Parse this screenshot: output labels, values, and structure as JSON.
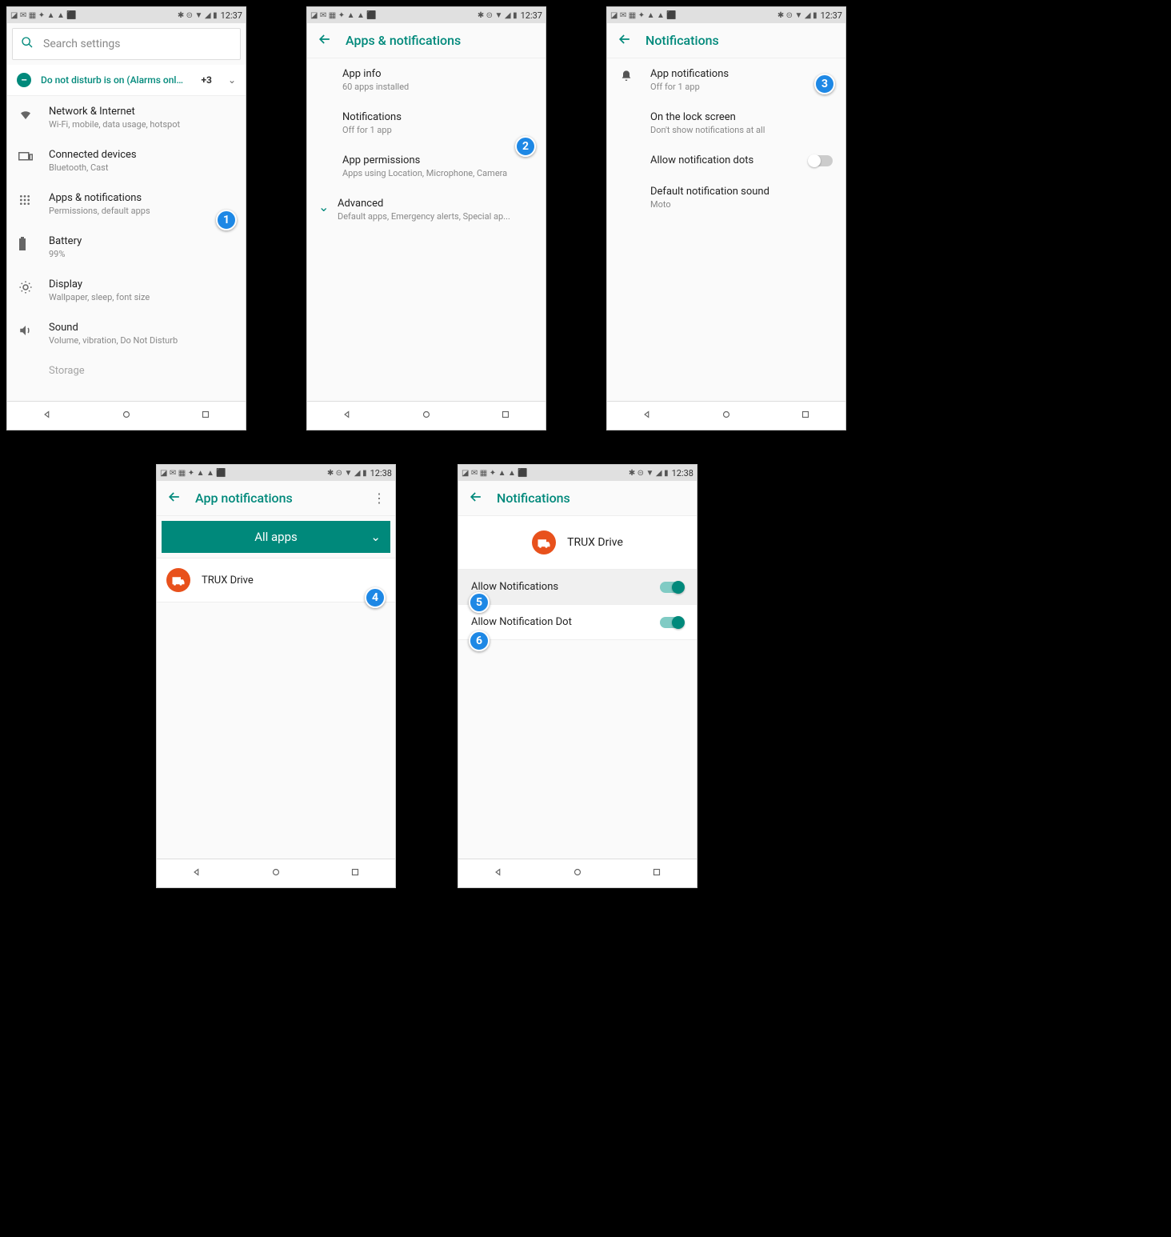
{
  "status_time_a": "12:37",
  "status_time_b": "12:38",
  "phone1": {
    "search_placeholder": "Search settings",
    "dnd_text": "Do not disturb is on (Alarms onl…",
    "dnd_more": "+3",
    "items": [
      {
        "title": "Network & Internet",
        "sub": "Wi-Fi, mobile, data usage, hotspot"
      },
      {
        "title": "Connected devices",
        "sub": "Bluetooth, Cast"
      },
      {
        "title": "Apps & notifications",
        "sub": "Permissions, default apps"
      },
      {
        "title": "Battery",
        "sub": "99%"
      },
      {
        "title": "Display",
        "sub": "Wallpaper, sleep, font size"
      },
      {
        "title": "Sound",
        "sub": "Volume, vibration, Do Not Disturb"
      },
      {
        "title": "Storage",
        "sub": ""
      }
    ]
  },
  "phone2": {
    "header": "Apps & notifications",
    "items": [
      {
        "title": "App info",
        "sub": "60 apps installed"
      },
      {
        "title": "Notifications",
        "sub": "Off for 1 app"
      },
      {
        "title": "App permissions",
        "sub": "Apps using Location, Microphone, Camera"
      }
    ],
    "adv_title": "Advanced",
    "adv_sub": "Default apps, Emergency alerts, Special ap..."
  },
  "phone3": {
    "header": "Notifications",
    "items": [
      {
        "title": "App notifications",
        "sub": "Off for 1 app",
        "icon": true
      },
      {
        "title": "On the lock screen",
        "sub": "Don't show notifications at all"
      },
      {
        "title": "Allow notification dots",
        "toggle": true
      },
      {
        "title": "Default notification sound",
        "sub": "Moto"
      }
    ]
  },
  "phone4": {
    "header": "App notifications",
    "dropdown": "All apps",
    "app": "TRUX Drive"
  },
  "phone5": {
    "header": "Notifications",
    "app": "TRUX Drive",
    "row1": "Allow Notifications",
    "row2": "Allow Notification Dot"
  },
  "markers": [
    "1",
    "2",
    "3",
    "4",
    "5",
    "6"
  ]
}
